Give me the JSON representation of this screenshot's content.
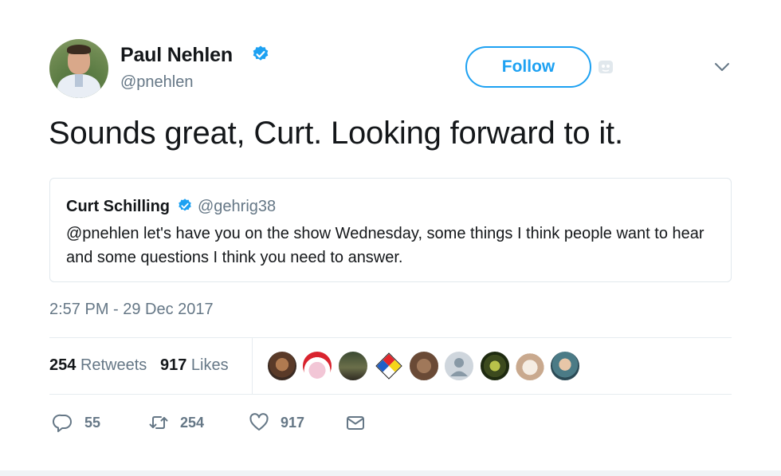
{
  "author": {
    "name": "Paul Nehlen",
    "handle": "@pnehlen",
    "follow_label": "Follow"
  },
  "tweet": {
    "text": "Sounds great, Curt. Looking forward to it."
  },
  "quoted": {
    "name": "Curt Schilling",
    "handle": "@gehrig38",
    "text": "@pnehlen let's have you on the show Wednesday, some things I think people want to hear and some questions I think you need to answer."
  },
  "timestamp": "2:57 PM - 29 Dec 2017",
  "stats": {
    "retweets_count": "254",
    "retweets_label": "Retweets",
    "likes_count": "917",
    "likes_label": "Likes"
  },
  "actions": {
    "reply_count": "55",
    "retweet_count": "254",
    "like_count": "917"
  },
  "colors": {
    "accent": "#1da1f2",
    "muted": "#657786",
    "text": "#14171a",
    "border": "#e1e8ed"
  },
  "icons": [
    "verified-icon",
    "birdie-icon",
    "chevron-down-icon",
    "reply-icon",
    "retweet-icon",
    "heart-icon",
    "mail-icon"
  ]
}
